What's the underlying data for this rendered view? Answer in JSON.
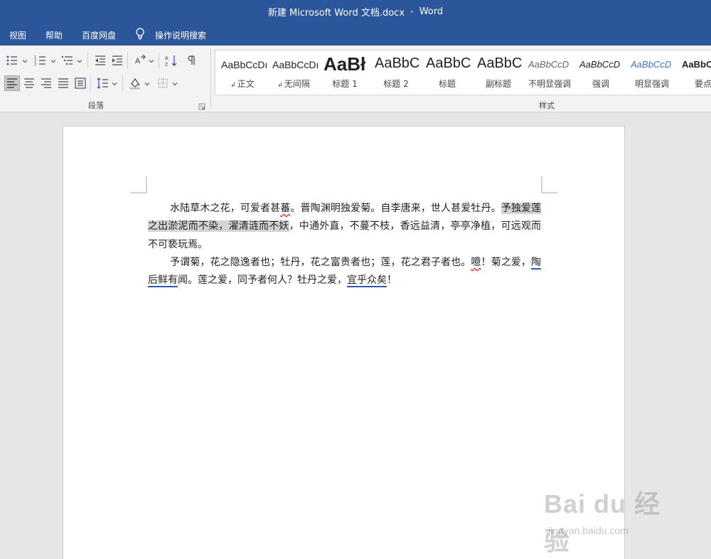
{
  "titlebar": {
    "doc_title": "新建 Microsoft Word 文档.docx",
    "separator": "-",
    "app_name": "Word"
  },
  "menu": {
    "tabs": [
      "视图",
      "帮助",
      "百度网盘"
    ],
    "tell_me": "操作说明搜索"
  },
  "ribbon": {
    "groups": {
      "paragraph": "段落",
      "styles": "样式"
    },
    "styles": [
      {
        "sample": "AaBbCcDı",
        "name": "正文",
        "has_mark": true
      },
      {
        "sample": "AaBbCcDı",
        "name": "无间隔",
        "has_mark": true
      },
      {
        "sample": "AaBł",
        "name": "标题 1",
        "has_mark": false
      },
      {
        "sample": "AaBbC",
        "name": "标题 2",
        "has_mark": false
      },
      {
        "sample": "AaBbC",
        "name": "标题",
        "has_mark": false
      },
      {
        "sample": "AaBbC",
        "name": "副标题",
        "has_mark": false
      },
      {
        "sample": "AaBbCcD",
        "name": "不明显强调",
        "has_mark": false
      },
      {
        "sample": "AaBbCcD",
        "name": "强调",
        "has_mark": false
      },
      {
        "sample": "AaBbCcD",
        "name": "明显强调",
        "has_mark": false
      },
      {
        "sample": "AaBbC",
        "name": "要点",
        "has_mark": false
      }
    ],
    "style_mark": "↲"
  },
  "document": {
    "p1": {
      "a": "水陆草木之花，可爱者甚",
      "b": "蕃",
      "c": "。晋陶渊明独爱菊。自李唐来，世人甚爱牡丹。",
      "d": "予独爱莲之出淤泥而不染，濯清涟而不妖",
      "e": "，中通外直，不蔓不枝，香远益清，亭亭净植，可远观而不可亵玩焉。"
    },
    "p2": {
      "a": "予谓菊，花之隐逸者也；牡丹，花之富贵者也；莲，花之君子者也。",
      "b": "噫",
      "c": "！菊之爱，",
      "d": "陶后鲜有",
      "e": "闻。莲之爱，同予者何人？牡丹之爱，",
      "f": "宜乎众矣",
      "g": "！"
    }
  },
  "watermark": {
    "logo": "Bai du 经验",
    "sub": "jingyan.baidu.com"
  }
}
